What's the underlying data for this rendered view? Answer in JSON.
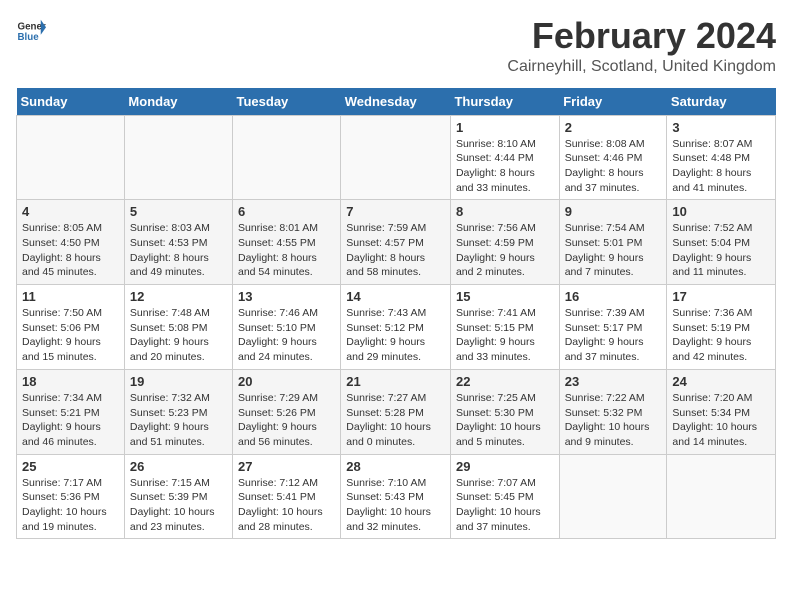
{
  "header": {
    "logo_general": "General",
    "logo_blue": "Blue",
    "title": "February 2024",
    "subtitle": "Cairneyhill, Scotland, United Kingdom"
  },
  "days_of_week": [
    "Sunday",
    "Monday",
    "Tuesday",
    "Wednesday",
    "Thursday",
    "Friday",
    "Saturday"
  ],
  "weeks": [
    [
      {
        "day": "",
        "content": ""
      },
      {
        "day": "",
        "content": ""
      },
      {
        "day": "",
        "content": ""
      },
      {
        "day": "",
        "content": ""
      },
      {
        "day": "1",
        "content": "Sunrise: 8:10 AM\nSunset: 4:44 PM\nDaylight: 8 hours\nand 33 minutes."
      },
      {
        "day": "2",
        "content": "Sunrise: 8:08 AM\nSunset: 4:46 PM\nDaylight: 8 hours\nand 37 minutes."
      },
      {
        "day": "3",
        "content": "Sunrise: 8:07 AM\nSunset: 4:48 PM\nDaylight: 8 hours\nand 41 minutes."
      }
    ],
    [
      {
        "day": "4",
        "content": "Sunrise: 8:05 AM\nSunset: 4:50 PM\nDaylight: 8 hours\nand 45 minutes."
      },
      {
        "day": "5",
        "content": "Sunrise: 8:03 AM\nSunset: 4:53 PM\nDaylight: 8 hours\nand 49 minutes."
      },
      {
        "day": "6",
        "content": "Sunrise: 8:01 AM\nSunset: 4:55 PM\nDaylight: 8 hours\nand 54 minutes."
      },
      {
        "day": "7",
        "content": "Sunrise: 7:59 AM\nSunset: 4:57 PM\nDaylight: 8 hours\nand 58 minutes."
      },
      {
        "day": "8",
        "content": "Sunrise: 7:56 AM\nSunset: 4:59 PM\nDaylight: 9 hours\nand 2 minutes."
      },
      {
        "day": "9",
        "content": "Sunrise: 7:54 AM\nSunset: 5:01 PM\nDaylight: 9 hours\nand 7 minutes."
      },
      {
        "day": "10",
        "content": "Sunrise: 7:52 AM\nSunset: 5:04 PM\nDaylight: 9 hours\nand 11 minutes."
      }
    ],
    [
      {
        "day": "11",
        "content": "Sunrise: 7:50 AM\nSunset: 5:06 PM\nDaylight: 9 hours\nand 15 minutes."
      },
      {
        "day": "12",
        "content": "Sunrise: 7:48 AM\nSunset: 5:08 PM\nDaylight: 9 hours\nand 20 minutes."
      },
      {
        "day": "13",
        "content": "Sunrise: 7:46 AM\nSunset: 5:10 PM\nDaylight: 9 hours\nand 24 minutes."
      },
      {
        "day": "14",
        "content": "Sunrise: 7:43 AM\nSunset: 5:12 PM\nDaylight: 9 hours\nand 29 minutes."
      },
      {
        "day": "15",
        "content": "Sunrise: 7:41 AM\nSunset: 5:15 PM\nDaylight: 9 hours\nand 33 minutes."
      },
      {
        "day": "16",
        "content": "Sunrise: 7:39 AM\nSunset: 5:17 PM\nDaylight: 9 hours\nand 37 minutes."
      },
      {
        "day": "17",
        "content": "Sunrise: 7:36 AM\nSunset: 5:19 PM\nDaylight: 9 hours\nand 42 minutes."
      }
    ],
    [
      {
        "day": "18",
        "content": "Sunrise: 7:34 AM\nSunset: 5:21 PM\nDaylight: 9 hours\nand 46 minutes."
      },
      {
        "day": "19",
        "content": "Sunrise: 7:32 AM\nSunset: 5:23 PM\nDaylight: 9 hours\nand 51 minutes."
      },
      {
        "day": "20",
        "content": "Sunrise: 7:29 AM\nSunset: 5:26 PM\nDaylight: 9 hours\nand 56 minutes."
      },
      {
        "day": "21",
        "content": "Sunrise: 7:27 AM\nSunset: 5:28 PM\nDaylight: 10 hours\nand 0 minutes."
      },
      {
        "day": "22",
        "content": "Sunrise: 7:25 AM\nSunset: 5:30 PM\nDaylight: 10 hours\nand 5 minutes."
      },
      {
        "day": "23",
        "content": "Sunrise: 7:22 AM\nSunset: 5:32 PM\nDaylight: 10 hours\nand 9 minutes."
      },
      {
        "day": "24",
        "content": "Sunrise: 7:20 AM\nSunset: 5:34 PM\nDaylight: 10 hours\nand 14 minutes."
      }
    ],
    [
      {
        "day": "25",
        "content": "Sunrise: 7:17 AM\nSunset: 5:36 PM\nDaylight: 10 hours\nand 19 minutes."
      },
      {
        "day": "26",
        "content": "Sunrise: 7:15 AM\nSunset: 5:39 PM\nDaylight: 10 hours\nand 23 minutes."
      },
      {
        "day": "27",
        "content": "Sunrise: 7:12 AM\nSunset: 5:41 PM\nDaylight: 10 hours\nand 28 minutes."
      },
      {
        "day": "28",
        "content": "Sunrise: 7:10 AM\nSunset: 5:43 PM\nDaylight: 10 hours\nand 32 minutes."
      },
      {
        "day": "29",
        "content": "Sunrise: 7:07 AM\nSunset: 5:45 PM\nDaylight: 10 hours\nand 37 minutes."
      },
      {
        "day": "",
        "content": ""
      },
      {
        "day": "",
        "content": ""
      }
    ]
  ]
}
